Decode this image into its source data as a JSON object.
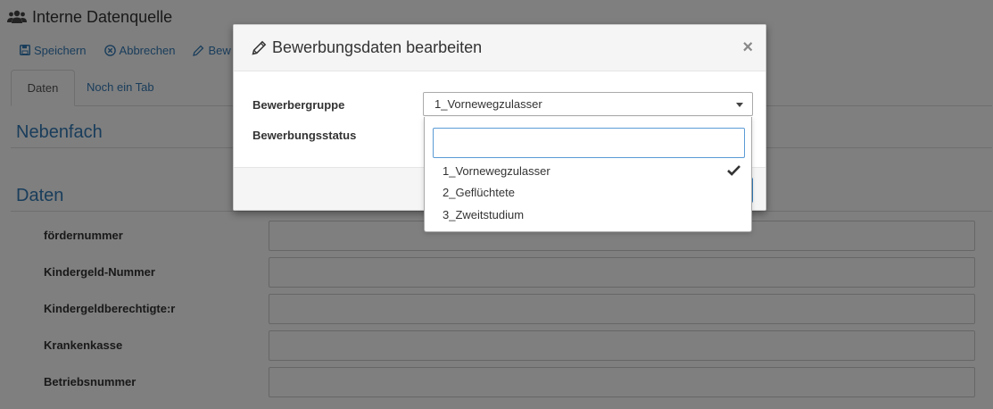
{
  "page": {
    "title": "Interne Datenquelle",
    "toolbar": {
      "save_label": "Speichern",
      "cancel_label": "Abbrechen",
      "edit_label": "Bew"
    },
    "tabs": [
      {
        "label": "Daten",
        "active": true
      },
      {
        "label": "Noch ein Tab",
        "active": false
      }
    ],
    "sections": {
      "nebenfach_title": "Nebenfach",
      "daten_title": "Daten"
    },
    "fields": [
      {
        "label": "fördernummer",
        "value": ""
      },
      {
        "label": "Kindergeld-Nummer",
        "value": ""
      },
      {
        "label": "Kindergeldberechtigte:r",
        "value": ""
      },
      {
        "label": "Krankenkasse",
        "value": ""
      },
      {
        "label": "Betriebsnummer",
        "value": ""
      }
    ]
  },
  "modal": {
    "title": "Bewerbungsdaten bearbeiten",
    "close_label": "×",
    "fields": {
      "bewerbergruppe_label": "Bewerbergruppe",
      "bewerbergruppe_value": "1_Vornewegzulasser",
      "bewerbungsstatus_label": "Bewerbungsstatus"
    }
  },
  "dropdown": {
    "search_value": "",
    "options": [
      {
        "label": "1_Vornewegzulasser",
        "selected": true
      },
      {
        "label": "2_Geflüchtete",
        "selected": false
      },
      {
        "label": "3_Zweitstudium",
        "selected": false
      }
    ]
  },
  "colors": {
    "link": "#337ab7",
    "backdrop": "rgba(0,0,0,0.5)",
    "focus": "#5b9bd5"
  }
}
